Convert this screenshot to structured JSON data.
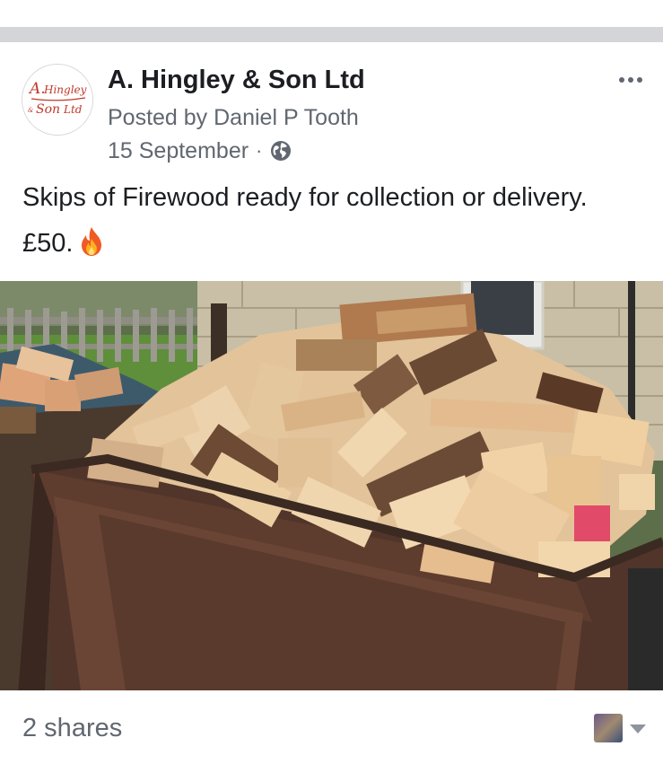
{
  "post": {
    "page_name": "A. Hingley & Son Ltd",
    "posted_by": "Posted by Daniel P Tooth",
    "date": "15 September",
    "separator": "·",
    "audience_icon": "globe-icon",
    "avatar_logo_text": "A. Hingley & Son Ltd",
    "text": "Skips of Firewood ready for collection or delivery. £50.",
    "emoji": "fire-emoji",
    "shares": "2 shares"
  },
  "colors": {
    "primary_text": "#1c1e21",
    "secondary_text": "#606770",
    "separator_band": "#d3d5d9",
    "logo_red": "#c0392b"
  }
}
